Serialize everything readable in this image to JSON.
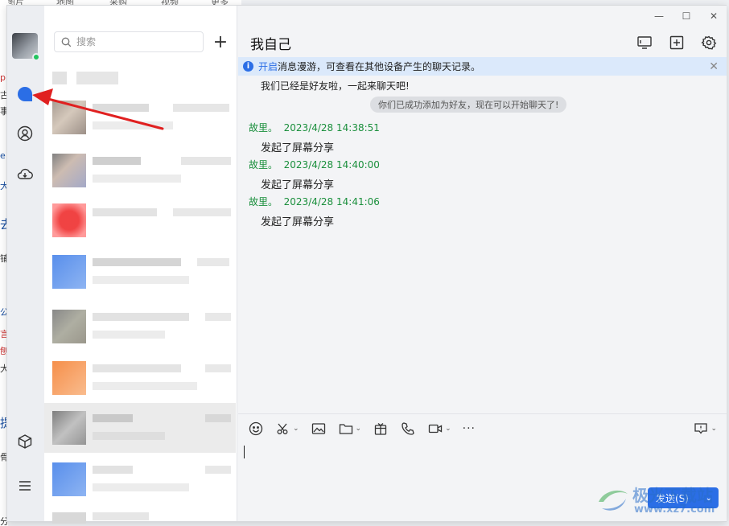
{
  "background": {
    "top_tabs": [
      "图片",
      "地图",
      "采购",
      "视频",
      "更多"
    ],
    "left_fragments": [
      "p",
      "古",
      "事",
      "e",
      "大",
      "去",
      "铺",
      "公",
      "言",
      "刨",
      "大",
      "提",
      "骨",
      "分"
    ]
  },
  "window": {
    "controls": {
      "minimize": "—",
      "maximize": "☐",
      "close": "✕"
    }
  },
  "sidebar": {
    "nav": [
      "chat-icon",
      "contact-icon",
      "cloud-icon",
      "app-box-icon",
      "menu-icon"
    ],
    "active_nav": "chat-icon"
  },
  "search": {
    "placeholder": "搜索",
    "value": ""
  },
  "add_label": "+",
  "chat": {
    "title": "我自己",
    "banner": {
      "link": "开启",
      "text": "消息漫游，可查看在其他设备产生的聊天记录。"
    },
    "intro": "我们已经是好友啦，一起来聊天吧!",
    "system_notice": "你们已成功添加为好友，现在可以开始聊天了!",
    "messages": [
      {
        "sender": "故里。",
        "time": "2023/4/28 14:38:51",
        "text": "发起了屏幕分享"
      },
      {
        "sender": "故里。",
        "time": "2023/4/28 14:40:00",
        "text": "发起了屏幕分享"
      },
      {
        "sender": "故里。",
        "time": "2023/4/28 14:41:06",
        "text": "发起了屏幕分享"
      }
    ],
    "toolbar": [
      "emoji-icon",
      "scissors-icon",
      "image-icon",
      "folder-icon",
      "gift-box-icon",
      "phone-icon",
      "video-icon",
      "more-icon"
    ],
    "more_label": "···",
    "send_label": "发送(S)",
    "input_value": ""
  },
  "watermark": {
    "brand": "极光下载站",
    "url": "www.xz7.com"
  },
  "colors": {
    "accent": "#2b6ee6",
    "sender": "#1a8f3c",
    "annotation_arrow": "#e02020"
  }
}
